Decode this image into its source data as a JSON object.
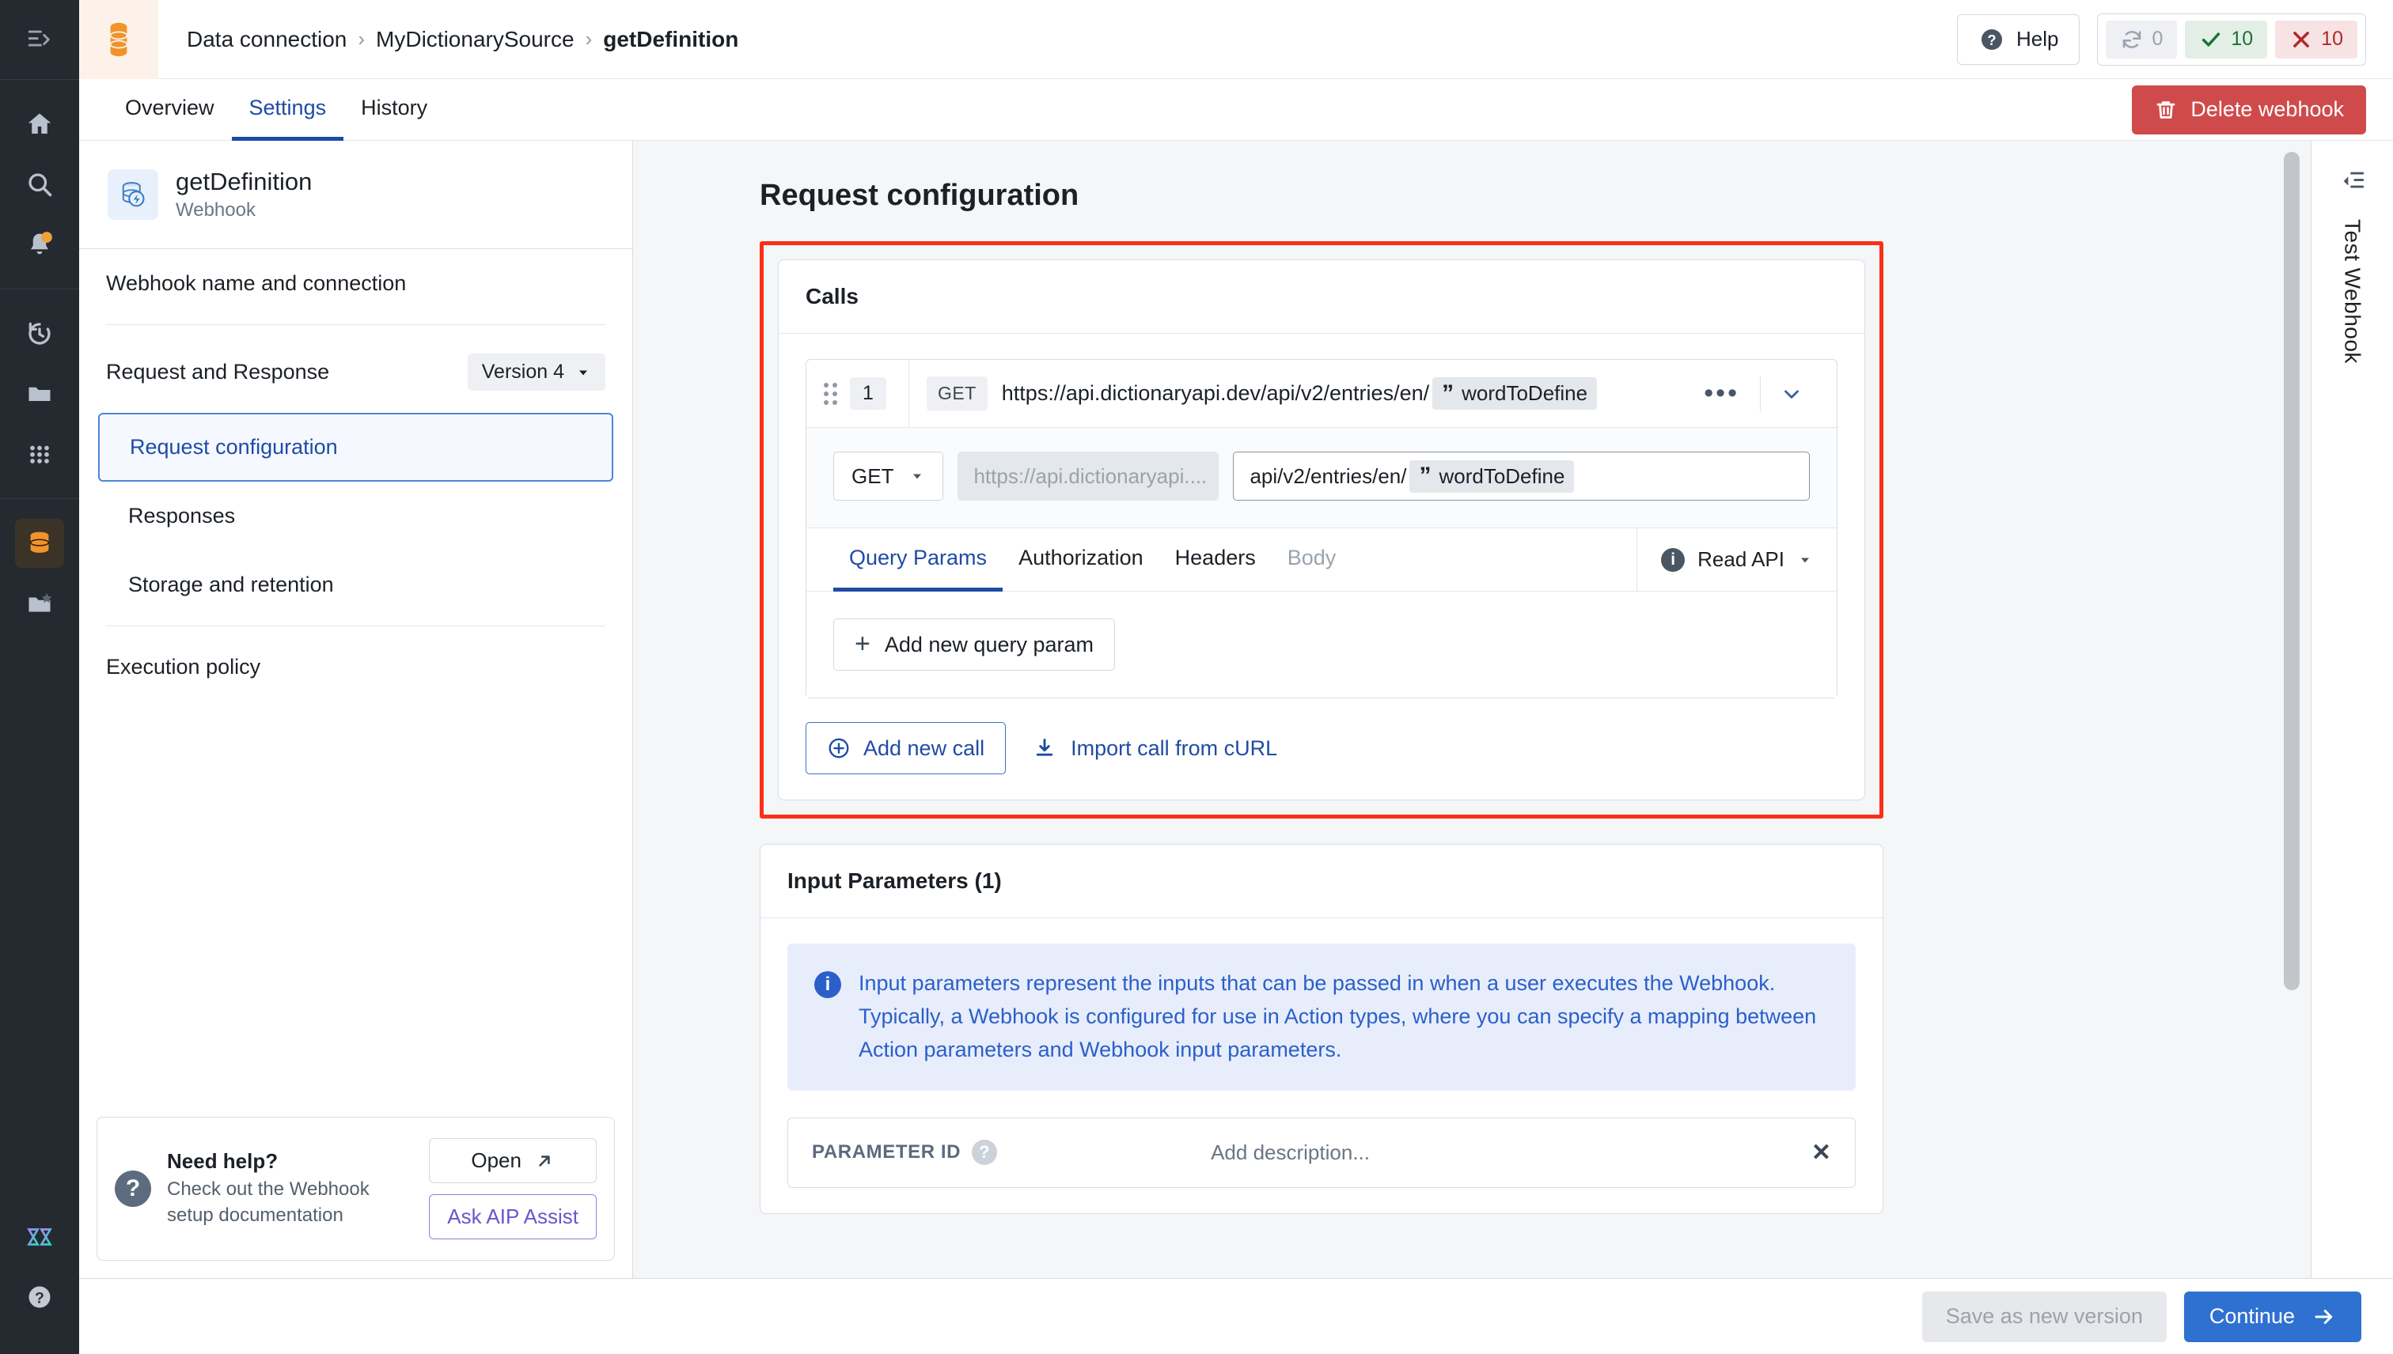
{
  "rail": {
    "collapse_icon": "panel-collapse-icon",
    "items": [
      {
        "icon": "home-icon",
        "name": "home"
      },
      {
        "icon": "search-icon",
        "name": "search"
      },
      {
        "icon": "bell-icon",
        "name": "notifications",
        "badge": true
      },
      {
        "icon": "history-icon",
        "name": "history"
      },
      {
        "icon": "folder-icon",
        "name": "files"
      },
      {
        "icon": "grid-apps-icon",
        "name": "apps"
      },
      {
        "icon": "database-icon",
        "name": "data-connection",
        "active": true
      },
      {
        "icon": "folder-star-icon",
        "name": "favorites"
      }
    ],
    "bottom": [
      {
        "icon": "aip-logo-icon",
        "name": "aip-assist"
      },
      {
        "icon": "question-circle-icon",
        "name": "help"
      }
    ]
  },
  "topbar": {
    "logo_icon": "database-stack-icon",
    "breadcrumbs": [
      "Data connection",
      "MyDictionarySource",
      "getDefinition"
    ],
    "separator": "›",
    "help_label": "Help",
    "help_icon": "question-circle-icon",
    "stats": {
      "running": {
        "icon": "refresh-icon",
        "value": "0"
      },
      "success": {
        "icon": "check-icon",
        "value": "10"
      },
      "failure": {
        "icon": "cross-icon",
        "value": "10"
      }
    }
  },
  "tabs": {
    "items": [
      {
        "label": "Overview",
        "active": false
      },
      {
        "label": "Settings",
        "active": true
      },
      {
        "label": "History",
        "active": false
      }
    ],
    "delete_label": "Delete webhook",
    "delete_icon": "trash-icon",
    "delete_color": "#cf4b4b"
  },
  "navpanel": {
    "icon": "webhook-database-icon",
    "title": "getDefinition",
    "subtitle": "Webhook",
    "rows": [
      {
        "label": "Webhook name and connection"
      },
      {
        "label": "Request and Response",
        "pill": "Version 4"
      },
      {
        "label": "Request configuration",
        "sub": true,
        "selected": true
      },
      {
        "label": "Responses",
        "sub": true
      },
      {
        "label": "Storage and retention",
        "sub": true
      },
      {
        "label": "Execution policy"
      }
    ],
    "help": {
      "icon": "question-circle-icon",
      "title": "Need help?",
      "desc": "Check out the Webhook setup documentation",
      "open_label": "Open",
      "open_icon": "external-link-icon",
      "aip_label": "Ask AIP Assist"
    }
  },
  "main": {
    "page_title": "Request configuration",
    "calls": {
      "header": "Calls",
      "row": {
        "drag_icon": "drag-handle-icon",
        "number": "1",
        "method_chip": "GET",
        "url_prefix": "https://api.dictionaryapi.dev/api/v2/entries/en/",
        "token_icon": "”",
        "token_label": "wordToDefine",
        "more_icon": "more-horizontal-icon",
        "chevron_icon": "chevron-down-icon"
      },
      "editor": {
        "method_value": "GET",
        "base_url_placeholder": "https://api.dictionaryapi....",
        "path_prefix": "api/v2/entries/en/",
        "path_token_icon": "”",
        "path_token_label": "wordToDefine"
      },
      "subtabs": [
        {
          "label": "Query Params",
          "active": true
        },
        {
          "label": "Authorization",
          "active": false
        },
        {
          "label": "Headers",
          "active": false
        },
        {
          "label": "Body",
          "active": false,
          "dim": true
        }
      ],
      "read_api": {
        "icon": "info-icon",
        "label": "Read API",
        "chevron": "chevron-down-icon"
      },
      "add_query_param": "Add new query param",
      "add_new_call": "Add new call",
      "add_new_call_icon": "plus-circle-icon",
      "import_curl": "Import call from cURL",
      "import_curl_icon": "download-icon"
    },
    "input_parameters": {
      "header": "Input Parameters (1)",
      "banner_icon": "info-icon",
      "banner_text": "Input parameters represent the inputs that can be passed in when a user executes the Webhook. Typically, a Webhook is configured for use in Action types, where you can specify a mapping between Action parameters and Webhook input parameters.",
      "row": {
        "label": "PARAMETER ID",
        "help_icon": "question-circle-icon",
        "description_placeholder": "Add description...",
        "close_icon": "✕"
      }
    },
    "highlight_color": "#fc2f18"
  },
  "testpanel": {
    "toggle_icon": "panel-expand-icon",
    "label": "Test Webhook"
  },
  "bottombar": {
    "save_label": "Save as new version",
    "continue_label": "Continue",
    "continue_icon": "arrow-right-icon",
    "accent": "#2f71d1"
  }
}
